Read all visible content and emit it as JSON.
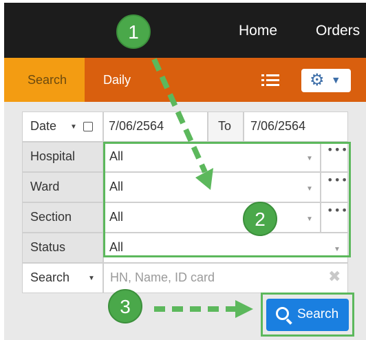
{
  "nav": {
    "home": "Home",
    "orders": "Orders"
  },
  "tabs": {
    "search": "Search",
    "daily": "Daily"
  },
  "icons": {
    "list": "list-icon",
    "gear": "gear-icon",
    "caret": "caret-down-icon"
  },
  "form": {
    "date_label": "Date",
    "date_from": "7/06/2564",
    "to_label": "To",
    "date_to": "7/06/2564",
    "rows": [
      {
        "label": "Hospital",
        "value": "All"
      },
      {
        "label": "Ward",
        "value": "All"
      },
      {
        "label": "Section",
        "value": "All"
      },
      {
        "label": "Status",
        "value": "All"
      }
    ],
    "search_mode": "Search",
    "search_placeholder": "HN, Name, ID card",
    "search_button": "Search"
  },
  "callouts": {
    "one": "1",
    "two": "2",
    "three": "3"
  },
  "colors": {
    "accent_green": "#5cb85c",
    "button_blue": "#1a7fe0",
    "tab_orange": "#d95f0e",
    "tab_active": "#f39c12"
  }
}
